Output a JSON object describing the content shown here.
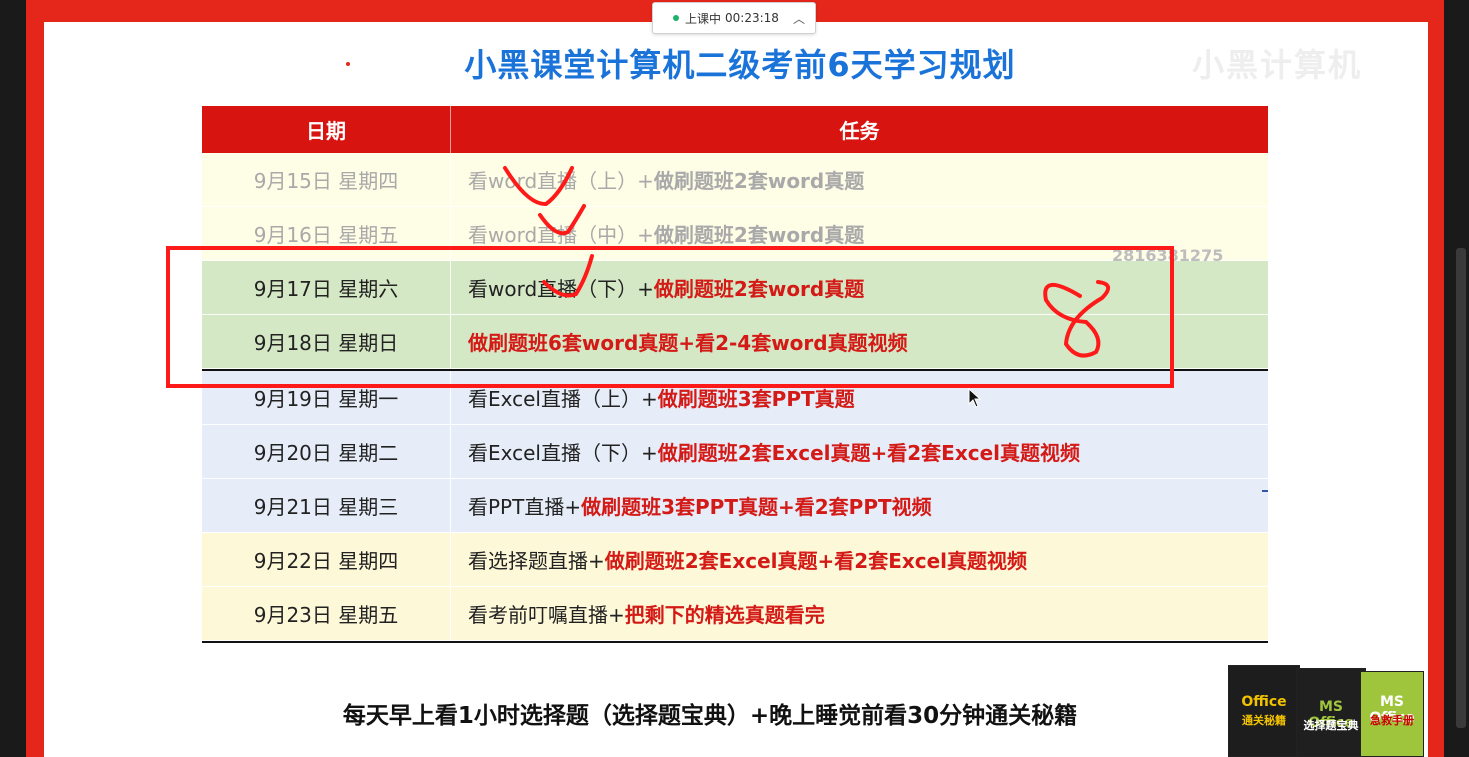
{
  "timer": {
    "status": "上课中",
    "time": "00:23:18"
  },
  "title": "小黑课堂计算机二级考前6天学习规划",
  "watermark": "小黑计算机",
  "qq_number": "2816381275",
  "table": {
    "header": {
      "date": "日期",
      "task": "任务"
    },
    "rows": [
      {
        "date": "9月15日 星期四",
        "task_plain": "看word直播（上）+",
        "task_highlight": "做刷题班2套word真题",
        "faded": true,
        "bg": "yellow"
      },
      {
        "date": "9月16日 星期五",
        "task_plain": "看word直播（中）+",
        "task_highlight": "做刷题班2套word真题",
        "faded": true,
        "bg": "yellow"
      },
      {
        "date": "9月17日 星期六",
        "task_plain": "看word直播（下）+",
        "task_highlight": "做刷题班2套word真题",
        "faded": false,
        "bg": "green"
      },
      {
        "date": "9月18日 星期日",
        "task_plain": "",
        "task_highlight": "做刷题班6套word真题+看2-4套word真题视频",
        "faded": false,
        "bg": "green"
      },
      {
        "date": "9月19日 星期一",
        "task_plain": "看Excel直播（上）+",
        "task_highlight": "做刷题班3套PPT真题",
        "faded": false,
        "bg": "blue"
      },
      {
        "date": "9月20日 星期二",
        "task_plain": "看Excel直播（下）+",
        "task_highlight": "做刷题班2套Excel真题+看2套Excel真题视频",
        "faded": false,
        "bg": "blue"
      },
      {
        "date": "9月21日 星期三",
        "task_plain": "看PPT直播+",
        "task_highlight": "做刷题班3套PPT真题+看2套PPT视频",
        "faded": false,
        "bg": "blue"
      },
      {
        "date": "9月22日 星期四",
        "task_plain": "看选择题直播+",
        "task_highlight": "做刷题班2套Excel真题+看2套Excel真题视频",
        "faded": false,
        "bg": "cream"
      },
      {
        "date": "9月23日 星期五",
        "task_plain": "看考前叮嘱直播+",
        "task_highlight": "把剩下的精选真题看完",
        "faded": false,
        "bg": "cream"
      }
    ]
  },
  "footer": "每天早上看1小时选择题（选择题宝典）+晚上睡觉前看30分钟通关秘籍",
  "books": [
    {
      "title": "Office",
      "subtitle": "通关秘籍"
    },
    {
      "title": "MS Office",
      "subtitle": "选择题宝典"
    },
    {
      "title": "MS Office",
      "subtitle": "急救手册"
    }
  ],
  "handwritten_annotation": "8",
  "colors": {
    "frame_red": "#e5261b",
    "title_blue": "#1a73d9",
    "header_red": "#d7140f",
    "highlight_red": "#d41a16",
    "annotation_red": "#ff1a1a"
  }
}
